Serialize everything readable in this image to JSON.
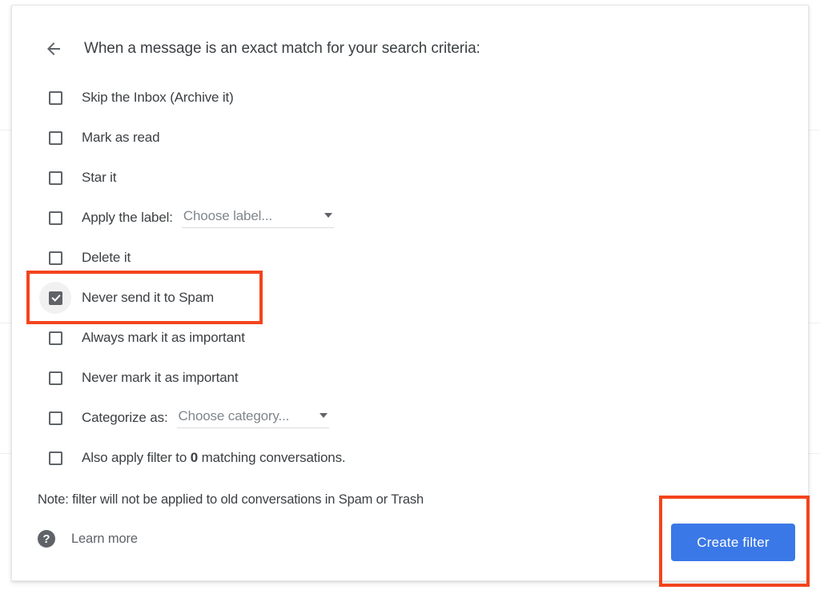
{
  "header": {
    "back_icon": "arrow-left-icon",
    "title": "When a message is an exact match for your search criteria:"
  },
  "options": [
    {
      "label": "Skip the Inbox (Archive it)",
      "checked": false,
      "name": "skip-inbox"
    },
    {
      "label": "Mark as read",
      "checked": false,
      "name": "mark-as-read"
    },
    {
      "label": "Star it",
      "checked": false,
      "name": "star-it"
    },
    {
      "label": "Apply the label:",
      "checked": false,
      "name": "apply-label",
      "dropdown": "Choose label..."
    },
    {
      "label": "Delete it",
      "checked": false,
      "name": "delete-it"
    },
    {
      "label": "Never send it to Spam",
      "checked": true,
      "name": "never-send-to-spam"
    },
    {
      "label": "Always mark it as important",
      "checked": false,
      "name": "always-mark-important"
    },
    {
      "label": "Never mark it as important",
      "checked": false,
      "name": "never-mark-important"
    },
    {
      "label": "Categorize as:",
      "checked": false,
      "name": "categorize-as",
      "dropdown": "Choose category..."
    },
    {
      "label": "Also apply filter to 0 matching conversations.",
      "checked": false,
      "name": "also-apply-filter",
      "rich": {
        "before": "Also apply filter to ",
        "bold": "0",
        "after": " matching conversations."
      }
    }
  ],
  "footer": {
    "note": "Note: filter will not be applied to old conversations in Spam or Trash",
    "help_icon": "help-circle-icon",
    "learn_more": "Learn more",
    "create_filter_label": "Create filter"
  },
  "colors": {
    "accent_blue": "#3b78e7",
    "annotation_red": "#f2441d",
    "text_primary": "#3c4043",
    "text_secondary": "#5f6368",
    "placeholder": "#80868b"
  },
  "annotations": [
    {
      "name": "annotation-spam-row",
      "target": "Never send it to Spam"
    },
    {
      "name": "annotation-create-filter",
      "target": "Create filter"
    }
  ]
}
